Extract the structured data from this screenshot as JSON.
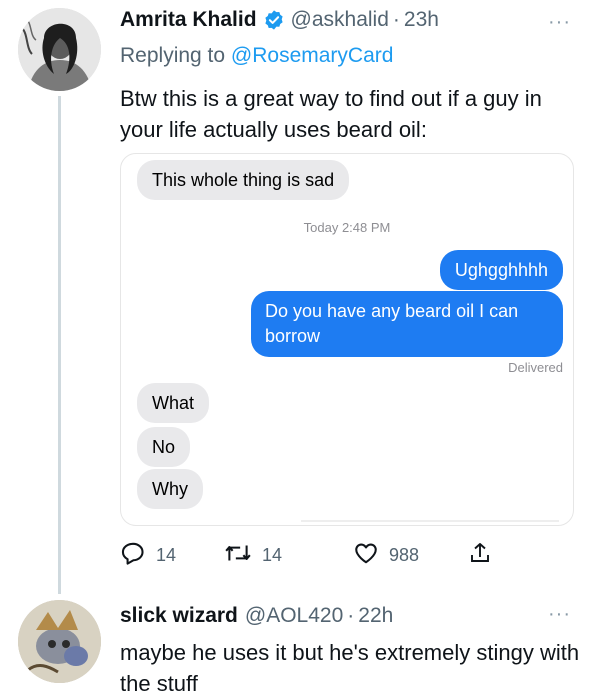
{
  "tweet": {
    "author_name": "Amrita Khalid",
    "author_handle": "@askhalid",
    "separator": "·",
    "time": "23h",
    "replying_prefix": "Replying to",
    "replying_to": "@RosemaryCard",
    "text": "Btw this is a great way to find out if a guy in your life actually uses beard oil:",
    "more_label": "···"
  },
  "messages": {
    "first": "This whole thing is sad",
    "timestamp": "Today 2:48 PM",
    "sent1": "Ughgghhhh",
    "sent2": "Do you have any beard oil I can borrow",
    "delivered": "Delivered",
    "reply1": "What",
    "reply2": "No",
    "reply3": "Why"
  },
  "actions": {
    "replies": "14",
    "retweets": "14",
    "likes": "988"
  },
  "reply": {
    "author_name": "slick wizard",
    "author_handle": "@AOL420",
    "separator": "·",
    "time": "22h",
    "text": "maybe he uses it but he's extremely stingy with the stuff",
    "more_label": "···"
  },
  "colors": {
    "link_blue": "#1d9bf0",
    "imessage_blue": "#1e7cf2",
    "imessage_gray": "#e9e9eb",
    "secondary_text": "#536471"
  },
  "icons": [
    "verified-badge-icon",
    "reply-icon",
    "retweet-icon",
    "like-icon",
    "share-icon",
    "more-icon"
  ]
}
